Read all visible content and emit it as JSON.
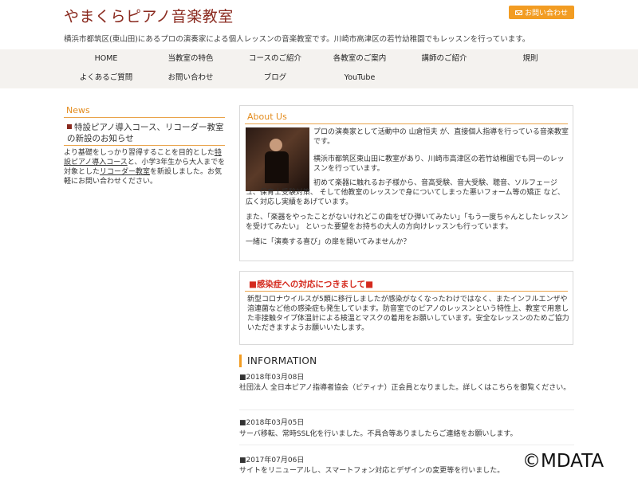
{
  "header": {
    "title": "やまくらピアノ音楽教室",
    "contact_label": "お問い合わせ",
    "tagline": "横浜市都筑区(東山田)にあるプロの演奏家による個人レッスンの音楽教室です。川崎市高津区の若竹幼稚園でもレッスンを行っています。"
  },
  "nav": {
    "row1": [
      "HOME",
      "当教室の特色",
      "コースのご紹介",
      "各教室のご案内",
      "講師のご紹介",
      "規則"
    ],
    "row2": [
      "よくあるご質問",
      "お問い合わせ",
      "ブログ",
      "YouTube"
    ]
  },
  "news": {
    "title": "News",
    "headline": "特設ピアノ導入コース、リコーダー教室の新設のお知らせ",
    "body_1": "より基礎をしっかり習得することを目的とした",
    "link_1": "特設ピアノ導入コース",
    "body_2": "と、小学3年生から大人までを対象とした",
    "link_2": "リコーダー教室",
    "body_3": "を新設しました。お気軽にお問い合わせください。"
  },
  "about": {
    "title": "About Us",
    "p1": "プロの演奏家として活動中の 山倉恒夫 が、直接個人指導を行っている音楽教室です。",
    "p2": "横浜市都筑区東山田に教室があり、川崎市高津区の若竹幼稚園でも同一のレッスンを行っています。",
    "p3": "初めて楽器に触れるお子様から、音高受験、音大受験、聴音、ソルフェージュ、保育士受験対策、 そして他教室のレッスンで身についてしまった悪いフォーム等の矯正 など、広く対応し実績をあげています。",
    "p4": "また、「楽器をやったことがないけれどこの曲をぜひ弾いてみたい」「もう一度ちゃんとしたレッスンを受けてみたい」 といった要望をお持ちの大人の方向けレッスンも行っています。",
    "p5": "一緒に「演奏する喜び」の扉を開いてみませんか？"
  },
  "covid": {
    "title": "■感染症への対応につきまして■",
    "text": "新型コロナウイルスが5類に移行しましたが感染がなくなったわけではなく、またインフルエンザや溶連菌など他の感染症も発生しています。防音室でのピアノのレッスンという特性上、教室で用意した非接触タイプ体温計による検温とマスクの着用をお願いしています。安全なレッスンのためご協力いただきますようお願いいたします。"
  },
  "information": {
    "title": "INFORMATION",
    "items": [
      {
        "date": "■2018年03月08日",
        "text": "社団法人 全日本ピアノ指導者協会（ピティナ）正会員となりました。詳しくはこちらを御覧ください。"
      },
      {
        "date": "■2018年03月05日",
        "text": "サーバ移転、常時SSL化を行いました。不具合等ありましたらご連絡をお願いします。"
      },
      {
        "date": "■2017年07月06日",
        "text": "サイトをリニューアルし、スマートフォン対応とデザインの変更等を行いました。"
      }
    ]
  },
  "watermark": "©MDATA",
  "colors": {
    "brand": "#8a2a1f",
    "accent": "#f29c22",
    "alert": "#d42a1e"
  }
}
